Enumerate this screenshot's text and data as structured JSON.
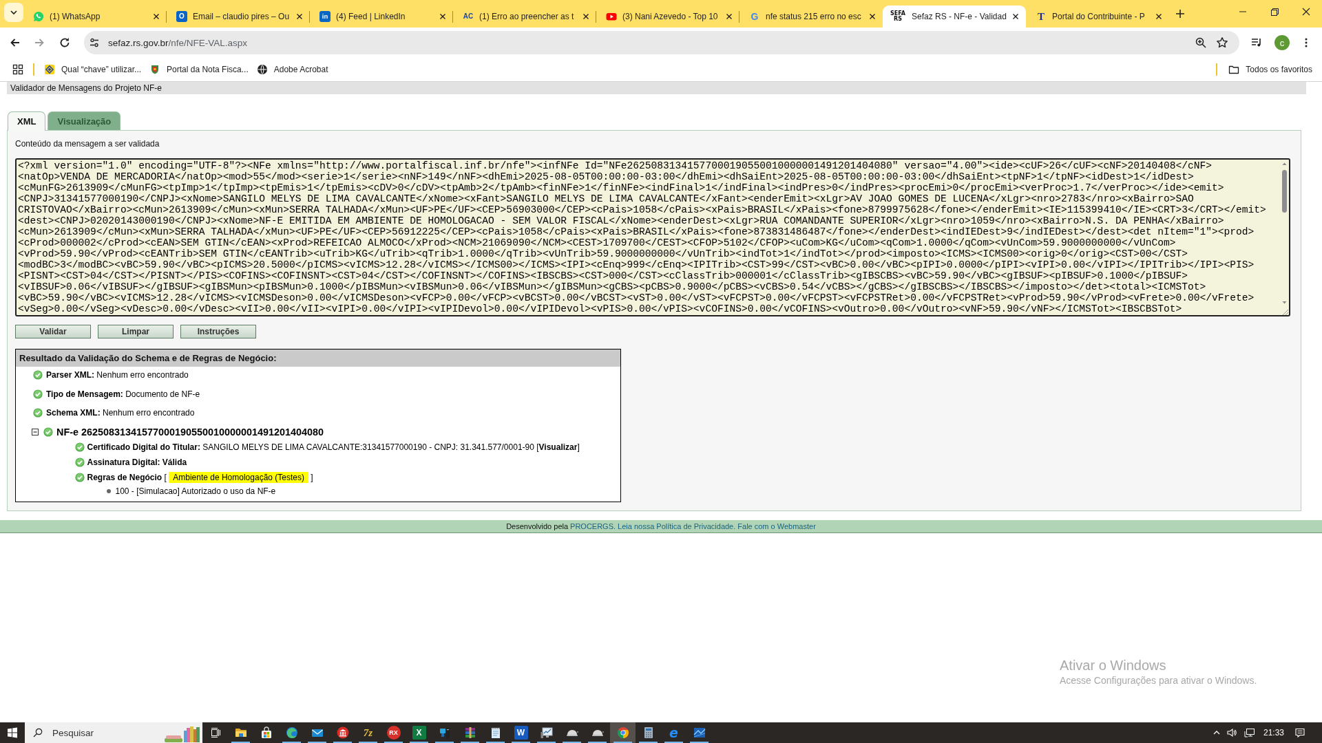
{
  "browser": {
    "tabs": [
      {
        "title": "(1) WhatsApp",
        "selected": false
      },
      {
        "title": "Email – claudio pires – Ou",
        "icon_text": "O",
        "selected": false
      },
      {
        "title": "(4) Feed | LinkedIn",
        "icon_text": "in",
        "selected": false
      },
      {
        "title": "(1) Erro ao preencher as t",
        "icon_text": "AC",
        "selected": false
      },
      {
        "title": "(3) Nani Azevedo - Top 10",
        "selected": false
      },
      {
        "title": "nfe status 215 erro no esc",
        "icon_text": "G",
        "selected": false
      },
      {
        "title": "Sefaz RS - NF-e - Validad",
        "icon_text": "SEFA RS",
        "selected": true
      },
      {
        "title": "Portal do Contribuinte - P",
        "icon_text": "T",
        "selected": false
      }
    ],
    "forward_disabled": true,
    "url": "sefaz.rs.gov.br/nfe/NFE-VAL.aspx",
    "profile_initial": "c",
    "bookmarks": [
      {
        "label": "Qual “chave” utilizar..."
      },
      {
        "label": "Portal da Nota Fisca..."
      },
      {
        "label": "Adobe Acrobat"
      }
    ],
    "all_bookmarks": "Todos os favoritos"
  },
  "page": {
    "header": "Validador de Mensagens do Projeto NF-e",
    "tabs": [
      {
        "label": "XML",
        "selected": true
      },
      {
        "label": "Visualização",
        "selected": false
      }
    ],
    "content_label": "Conteúdo da mensagem a ser validada",
    "xml_lines": [
      "<?xml version=\"1.0\" encoding=\"UTF-8\"?><NFe xmlns=\"http://www.portalfiscal.inf.br/nfe\"><infNFe Id=\"NFe26250831341577000190550010000001491201404080\" versao=\"4.00\"><ide><cUF>26</cUF><cNF>20140408</cNF>",
      "<natOp>VENDA DE MERCADORIA</natOp><mod>55</mod><serie>1</serie><nNF>149</nNF><dhEmi>2025-08-05T00:00:00-03:00</dhEmi><dhSaiEnt>2025-08-05T00:00:00-03:00</dhSaiEnt><tpNF>1</tpNF><idDest>1</idDest>",
      "<cMunFG>2613909</cMunFG><tpImp>1</tpImp><tpEmis>1</tpEmis><cDV>0</cDV><tpAmb>2</tpAmb><finNFe>1</finNFe><indFinal>1</indFinal><indPres>0</indPres><procEmi>0</procEmi><verProc>1.7</verProc></ide><emit>",
      "<CNPJ>31341577000190</CNPJ><xNome>SANGILO MELYS DE LIMA CAVALCANTE</xNome><xFant>SANGILO MELYS DE LIMA CAVALCANTE</xFant><enderEmit><xLgr>AV JOAO GOMES DE LUCENA</xLgr><nro>2783</nro><xBairro>SAO",
      "CRISTOVAO</xBairro><cMun>2613909</cMun><xMun>SERRA TALHADA</xMun><UF>PE</UF><CEP>56903000</CEP><cPais>1058</cPais><xPais>BRASIL</xPais><fone>8799975628</fone></enderEmit><IE>115399410</IE><CRT>3</CRT></emit>",
      "<dest><CNPJ>02020143000190</CNPJ><xNome>NF-E EMITIDA EM AMBIENTE DE HOMOLOGACAO - SEM VALOR FISCAL</xNome><enderDest><xLgr>RUA COMANDANTE SUPERIOR</xLgr><nro>1059</nro><xBairro>N.S. DA PENHA</xBairro>",
      "<cMun>2613909</cMun><xMun>SERRA TALHADA</xMun><UF>PE</UF><CEP>56912225</CEP><cPais>1058</cPais><xPais>BRASIL</xPais><fone>873831486487</fone></enderDest><indIEDest>9</indIEDest></dest><det nItem=\"1\"><prod>",
      "<cProd>000002</cProd><cEAN>SEM GTIN</cEAN><xProd>REFEICAO ALMOCO</xProd><NCM>21069090</NCM><CEST>1709700</CEST><CFOP>5102</CFOP><uCom>KG</uCom><qCom>1.0000</qCom><vUnCom>59.9000000000</vUnCom>",
      "<vProd>59.90</vProd><cEANTrib>SEM GTIN</cEANTrib><uTrib>KG</uTrib><qTrib>1.0000</qTrib><vUnTrib>59.9000000000</vUnTrib><indTot>1</indTot></prod><imposto><ICMS><ICMS00><orig>0</orig><CST>00</CST>",
      "<modBC>3</modBC><vBC>59.90</vBC><pICMS>20.5000</pICMS><vICMS>12.28</vICMS></ICMS00></ICMS><IPI><cEnq>999</cEnq><IPITrib><CST>99</CST><vBC>0.00</vBC><pIPI>0.0000</pIPI><vIPI>0.00</vIPI></IPITrib></IPI><PIS>",
      "<PISNT><CST>04</CST></PISNT></PIS><COFINS><COFINSNT><CST>04</CST></COFINSNT></COFINS><IBSCBS><CST>000</CST><cClassTrib>000001</cClassTrib><gIBSCBS><vBC>59.90</vBC><gIBSUF><pIBSUF>0.1000</pIBSUF>",
      "<vIBSUF>0.06</vIBSUF></gIBSUF><gIBSMun><pIBSMun>0.1000</pIBSMun><vIBSMun>0.06</vIBSMun></gIBSMun><gCBS><pCBS>0.9000</pCBS><vCBS>0.54</vCBS></gCBS></gIBSCBS></IBSCBS></imposto></det><total><ICMSTot>",
      "<vBC>59.90</vBC><vICMS>12.28</vICMS><vICMSDeson>0.00</vICMSDeson><vFCP>0.00</vFCP><vBCST>0.00</vBCST><vST>0.00</vST><vFCPST>0.00</vFCPST><vFCPSTRet>0.00</vFCPSTRet><vProd>59.90</vProd><vFrete>0.00</vFrete>",
      "<vSeg>0.00</vSeg><vDesc>0.00</vDesc><vII>0.00</vII><vIPI>0.00</vIPI><vIPIDevol>0.00</vIPIDevol><vPIS>0.00</vPIS><vCOFINS>0.00</vCOFINS><vOutro>0.00</vOutro><vNF>59.90</vNF></ICMSTot><IBSCBSTot>"
    ],
    "buttons": [
      "Validar",
      "Limpar",
      "Instruções"
    ],
    "result": {
      "title": "Resultado da Validação do Schema e de Regras de Negócio:",
      "items": [
        {
          "kind": "check",
          "label": "Parser XML:",
          "value": "Nenhum erro encontrado"
        },
        {
          "kind": "check",
          "label": "Tipo de Mensagem:",
          "value": "Documento de NF-e"
        },
        {
          "kind": "check",
          "label": "Schema XML:",
          "value": "Nenhum erro encontrado"
        },
        {
          "kind": "document",
          "label": "NF-e 26250831341577000190550010000001491201404080",
          "expanded": true,
          "children": [
            {
              "kind": "check",
              "label": "Certificado Digital do Titular:",
              "value": "SANGILO MELYS DE LIMA CAVALCANTE:31341577000190 - CNPJ: 31.341.577/0001-90 [**Visualizar**]"
            },
            {
              "kind": "check",
              "label": "Assinatura Digital: Válida"
            },
            {
              "kind": "check",
              "label": "Regras de Negócio",
              "value": "[",
              "highlight": "Ambiente de Homologação (Testes)",
              "value_after": "]",
              "children": [
                {
                  "kind": "bullet",
                  "label": "100 - [Simulacao] Autorizado o uso da NF-e"
                }
              ]
            }
          ]
        }
      ]
    },
    "footer": [
      {
        "kind": "text",
        "text": "Desenvolvido pela"
      },
      {
        "kind": "link",
        "text": "PROCERGS."
      },
      {
        "kind": "link",
        "text": "Leia nossa Política de Privacidade."
      },
      {
        "kind": "link",
        "text": "Fale com o Webmaster"
      }
    ]
  },
  "activation_notice": {
    "title": "Ativar o Windows",
    "text": "Acesse Configurações para ativar o Windows."
  },
  "taskbar": {
    "search_placeholder": "Pesquisar",
    "apps": [
      {
        "running": true,
        "selected": false
      },
      {
        "running": false,
        "selected": false
      },
      {
        "running": true,
        "selected": false
      },
      {
        "running": true,
        "selected": false
      },
      {
        "running": true,
        "selected": false
      },
      {
        "icon_text": "7z",
        "running": true,
        "selected": false
      },
      {
        "icon_text": "RX",
        "running": true,
        "selected": false
      },
      {
        "icon_text": "X",
        "running": true,
        "selected": false
      },
      {
        "running": true,
        "selected": false
      },
      {
        "running": true,
        "selected": false
      },
      {
        "running": true,
        "selected": false
      },
      {
        "icon_text": "W",
        "running": true,
        "selected": false
      },
      {
        "running": true,
        "selected": false
      },
      {
        "running": true,
        "selected": false
      },
      {
        "running": true,
        "selected": false
      },
      {
        "running": true,
        "selected": true
      },
      {
        "running": true,
        "selected": false
      },
      {
        "icon_text": "e",
        "running": true,
        "selected": false
      },
      {
        "running": true,
        "selected": false
      }
    ],
    "clock": "21:33"
  }
}
